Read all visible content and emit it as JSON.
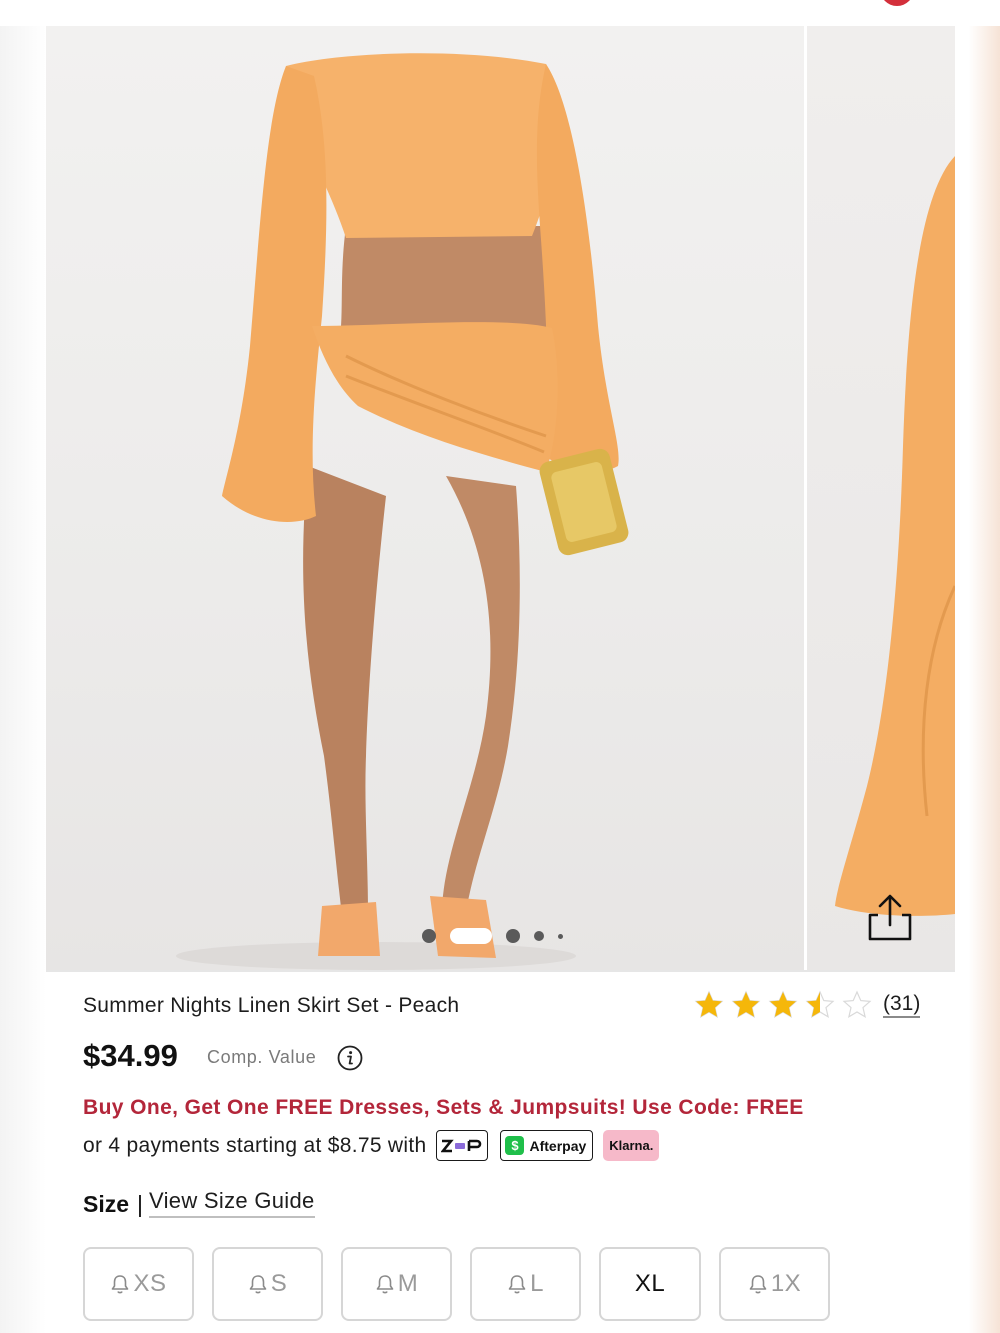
{
  "carousel": {
    "slide_count": 5,
    "active_index": 1
  },
  "product": {
    "title": "Summer Nights Linen Skirt Set - Peach",
    "rating": 3.5,
    "rating_max": 5,
    "review_count": "(31)",
    "price": "$34.99",
    "comp_value_label": "Comp. Value",
    "promo": "Buy One, Get One FREE Dresses, Sets & Jumpsuits! Use Code: FREE",
    "payments_text": "or 4 payments starting at $8.75 with",
    "payment_providers": {
      "zip": "zip",
      "afterpay": "Afterpay",
      "klarna": "Klarna."
    }
  },
  "size": {
    "label": "Size",
    "separator": "|",
    "guide_link": "View Size Guide",
    "options": [
      {
        "label": "XS",
        "available": false
      },
      {
        "label": "S",
        "available": false
      },
      {
        "label": "M",
        "available": false
      },
      {
        "label": "L",
        "available": false
      },
      {
        "label": "XL",
        "available": true
      },
      {
        "label": "1X",
        "available": false
      }
    ]
  },
  "colors": {
    "promo": "#b3263a",
    "star": "#f5b70a",
    "garment": "#f6b26b"
  }
}
